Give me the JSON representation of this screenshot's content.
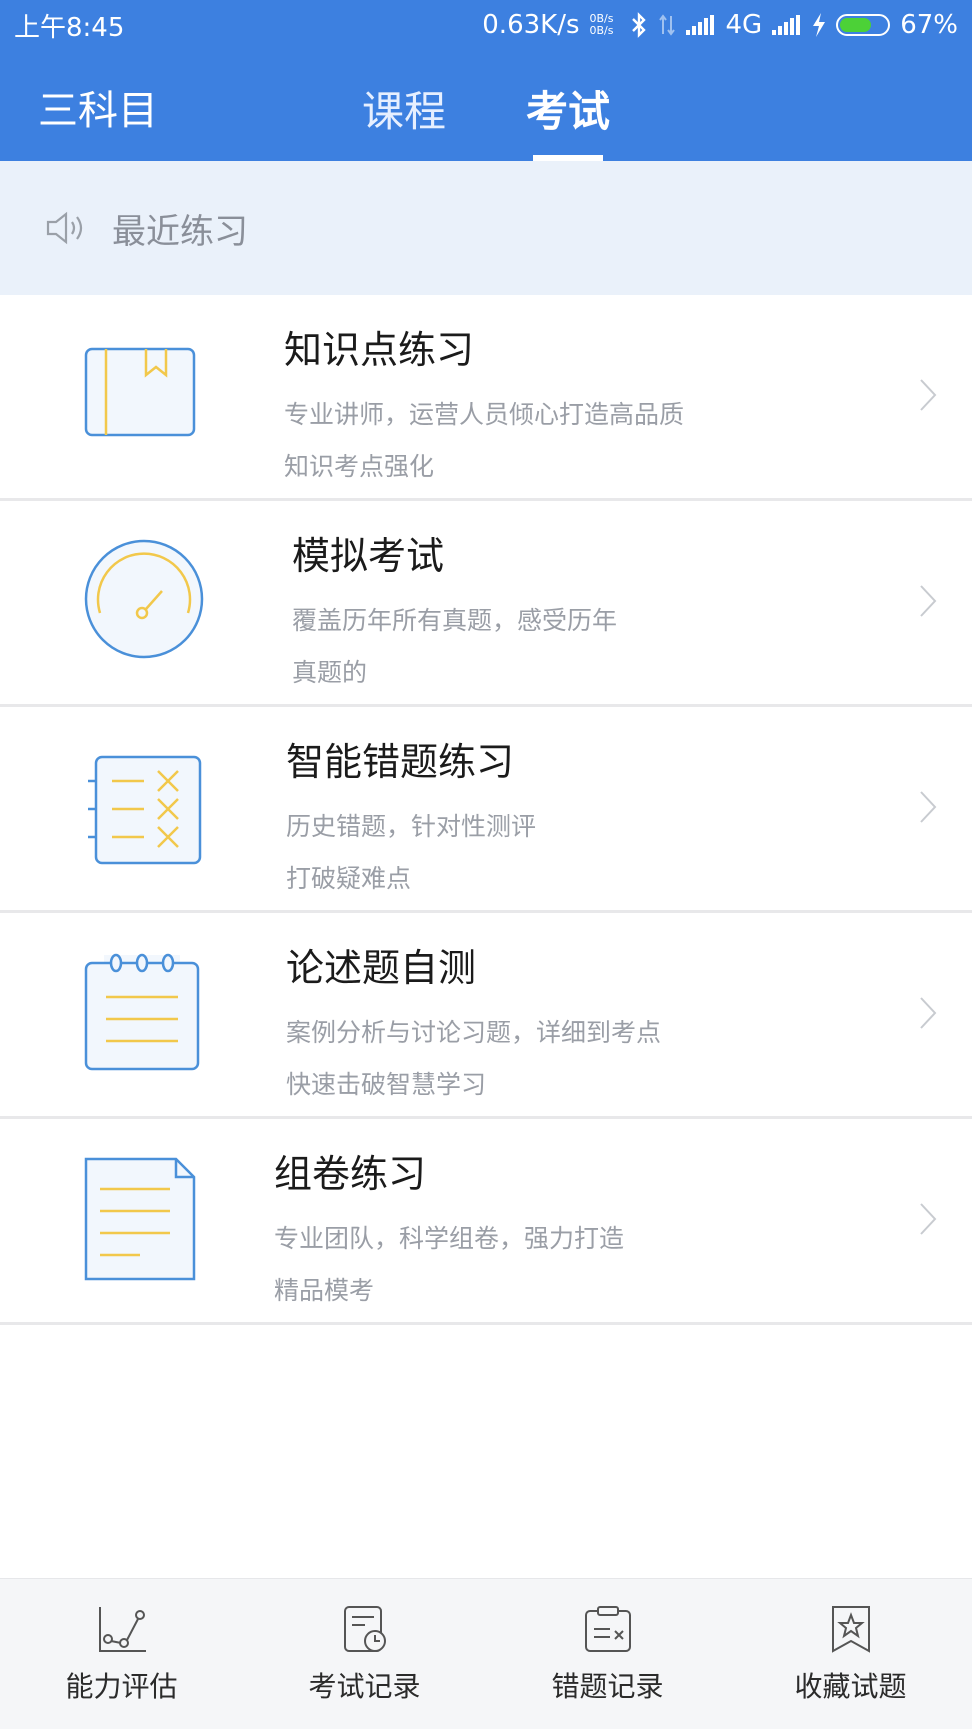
{
  "status_bar": {
    "time": "上午8:45",
    "net_speed": "0.63K/s",
    "net_up": "0B/s",
    "net_down": "0B/s",
    "network_type": "4G",
    "battery_percent": "67%",
    "battery_level": 0.67
  },
  "header": {
    "subject_label": "三科目",
    "tabs": [
      {
        "label": "课程",
        "active": false
      },
      {
        "label": "考试",
        "active": true
      }
    ]
  },
  "recent": {
    "label": "最近练习",
    "icon": "speaker-icon"
  },
  "items": [
    {
      "title": "知识点练习",
      "desc1": "专业讲师，运营人员倾心打造高品质",
      "desc2": "知识考点强化",
      "icon": "book-bookmark-icon"
    },
    {
      "title": "模拟考试",
      "desc1": "覆盖历年所有真题，感受历年",
      "desc2": "真题的",
      "icon": "gauge-icon"
    },
    {
      "title": "智能错题练习",
      "desc1": "历史错题，针对性测评",
      "desc2": "打破疑难点",
      "icon": "wrong-list-icon"
    },
    {
      "title": "论述题自测",
      "desc1": "案例分析与讨论习题，详细到考点",
      "desc2": "快速击破智慧学习",
      "icon": "notepad-icon"
    },
    {
      "title": "组卷练习",
      "desc1": "专业团队，科学组卷，强力打造",
      "desc2": "精品模考",
      "icon": "document-icon"
    }
  ],
  "bottom_nav": [
    {
      "label": "能力评估",
      "icon": "chart-icon"
    },
    {
      "label": "考试记录",
      "icon": "clock-doc-icon"
    },
    {
      "label": "错题记录",
      "icon": "clipboard-x-icon"
    },
    {
      "label": "收藏试题",
      "icon": "star-bookmark-icon"
    }
  ],
  "colors": {
    "brand_blue": "#3d80e0",
    "icon_blue": "#4a90d9",
    "icon_yellow": "#f2c84b"
  }
}
